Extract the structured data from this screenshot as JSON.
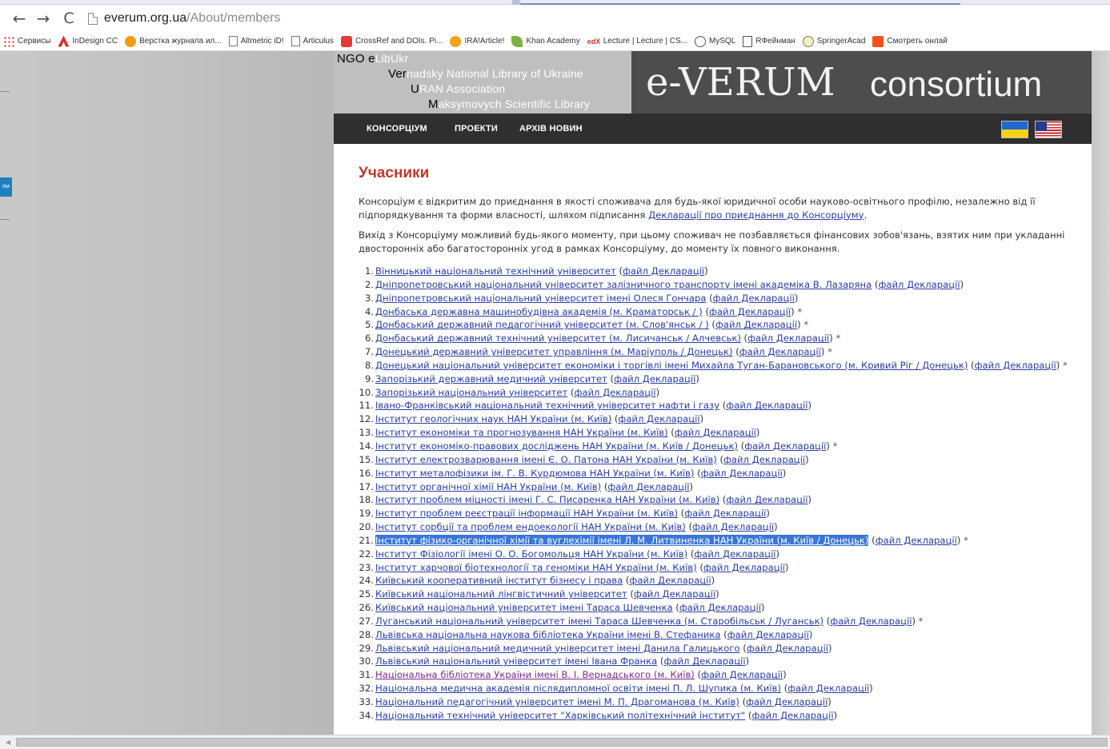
{
  "browser": {
    "url_domain": "everum.org.ua",
    "url_path": "/About/members",
    "back_icon": "←",
    "forward_icon": "→",
    "reload_icon": "C"
  },
  "bookmarks": [
    {
      "icon": "apps-icon",
      "label": "Сервисы"
    },
    {
      "icon": "adobe-icon",
      "label": "InDesign CC"
    },
    {
      "icon": "orange-icon",
      "label": "Верстка журнала ил..."
    },
    {
      "icon": "page-icon",
      "label": "Altmetric iD!"
    },
    {
      "icon": "page-icon",
      "label": "Articulus"
    },
    {
      "icon": "youtube-icon",
      "label": "CrossRef and DOIs. Pi..."
    },
    {
      "icon": "ira-icon",
      "label": "IRA!Article!"
    },
    {
      "icon": "leaf-icon",
      "label": "Khan Academy"
    },
    {
      "icon": "edx-icon",
      "label": "Lecture | Lecture | CS..."
    },
    {
      "icon": "mysql-icon",
      "label": "MySQL"
    },
    {
      "icon": "rf-icon",
      "label": "RФейнман"
    },
    {
      "icon": "springer-icon",
      "label": "SpringerAcad"
    },
    {
      "icon": "smotret-icon",
      "label": "Смотреть онлай"
    }
  ],
  "side_tab_text": "ем",
  "banner": {
    "lines": [
      {
        "hl": "NGO e",
        "rest": "LibUkr"
      },
      {
        "hl": "Ver",
        "rest": "nadsky National Library of Ukraine"
      },
      {
        "hl": "U",
        "rest": "RAN Association"
      },
      {
        "hl": "M",
        "rest": "aksymovych Scientific Library"
      }
    ],
    "logo_left": "e-VERUM",
    "logo_right": "consortium"
  },
  "nav": {
    "items": [
      "КОНСОРЦІУМ",
      "ПРОЕКТИ",
      "АРХІВ НОВИН"
    ]
  },
  "page": {
    "title": "Учасники",
    "para1_text": "Консорціум є відкритим до приєднання в якості споживача для будь-якої юридичної особи науково-освітнього профілю, незалежно від її підпорядкування та форми власності, шляхом підписання ",
    "para1_link": "Декларації про приєднання до Консорціуму",
    "para1_end": ".",
    "para2": "Вихід з Консорціуму можливий будь-якого моменту, при цьому споживач не позбавляється фінансових зобов'язань, взятих ним при укладанні двосторонніх або багатосторонніх угод в рамках Консорціуму, до моменту їх повного виконання.",
    "decl_label": "файл Декларації",
    "members": [
      {
        "n": "1.",
        "name": "Вінницький національний технічний університет",
        "star": ""
      },
      {
        "n": "2.",
        "name": "Дніпропетровський національний університет залізничного транспорту імені академіка В. Лазаряна",
        "star": ""
      },
      {
        "n": "3.",
        "name": "Дніпропетровський національний університет імені Олеся Гончара",
        "star": ""
      },
      {
        "n": "4.",
        "name": "Донбаська державна машинобудівна академія (м. Краматорськ / )",
        "star": "*"
      },
      {
        "n": "5.",
        "name": "Донбаський державний педагогічний університет (м. Слов'янськ / )",
        "star": "*"
      },
      {
        "n": "6.",
        "name": "Донбаський державний технічний університет (м. Лисичанськ / Алчевськ)",
        "star": "*"
      },
      {
        "n": "7.",
        "name": "Донецький державний університет управління (м. Маріуполь / Донецьк)",
        "star": "*"
      },
      {
        "n": "8.",
        "name": "Донецький національний університет економіки і торгівлі імені Михайла Туган-Барановського (м. Кривий Ріг / Донецьк)",
        "star": "*"
      },
      {
        "n": "9.",
        "name": "Запорізький державний медичний університет",
        "star": ""
      },
      {
        "n": "10.",
        "name": "Запорізький національний університет",
        "star": ""
      },
      {
        "n": "11.",
        "name": "Івано-Франківський національний технічний університет нафти і газу",
        "star": ""
      },
      {
        "n": "12.",
        "name": "Інститут геологічних наук НАН України (м. Київ)",
        "star": ""
      },
      {
        "n": "13.",
        "name": "Інститут економіки та прогнозування НАН України (м. Київ)",
        "star": ""
      },
      {
        "n": "14.",
        "name": "Інститут економіко-правових досліджень НАН України (м. Київ / Донецьк)",
        "star": "*"
      },
      {
        "n": "15.",
        "name": "Інститут електрозварювання імені Є. О. Патона НАН України (м. Київ)",
        "star": ""
      },
      {
        "n": "16.",
        "name": "Інститут металофізики ім. Г. В. Курдюмова НАН України (м. Київ)",
        "star": ""
      },
      {
        "n": "17.",
        "name": "Інститут органічної хімії НАН України (м. Київ)",
        "star": ""
      },
      {
        "n": "18.",
        "name": "Інститут проблем міцності імені Г. С. Писаренка НАН України (м. Київ)",
        "star": ""
      },
      {
        "n": "19.",
        "name": "Інститут проблем реєстрації інформації НАН України (м. Київ)",
        "star": ""
      },
      {
        "n": "20.",
        "name": "Інститут сорбції та проблем ендоекології НАН України (м. Київ)",
        "star": ""
      },
      {
        "n": "21.",
        "name": "Інститут фізико-органічної хімії та вуглехімії імені Л. М. Литвиненка НАН України (м. Київ / Донецьк)",
        "star": "*"
      },
      {
        "n": "22.",
        "name": "Інститут Фізіології імені О. О. Богомольця НАН України (м. Київ)",
        "star": ""
      },
      {
        "n": "23.",
        "name": "Інститут харчової біотехнології та геноміки НАН України (м. Київ)",
        "star": ""
      },
      {
        "n": "24.",
        "name": "Київський кооперативний інститут бізнесу і права",
        "star": ""
      },
      {
        "n": "25.",
        "name": "Київський національний лінгвістичний університет",
        "star": ""
      },
      {
        "n": "26.",
        "name": "Київський національний університет імені Тараса Шевченка",
        "star": ""
      },
      {
        "n": "27.",
        "name": "Луганський національний університет імені Тараса Шевченка (м. Старобільськ / Луганськ)",
        "star": "*"
      },
      {
        "n": "28.",
        "name": "Львівська національна наукова бібліотека України імені В. Стефаника",
        "star": ""
      },
      {
        "n": "29.",
        "name": "Львівський національний медичний університет імені Данила Галицького",
        "star": ""
      },
      {
        "n": "30.",
        "name": "Львівський національний університет імені Івана Франка",
        "star": ""
      },
      {
        "n": "31.",
        "name": "Національна бібліотека України імені В. І. Вернадського (м. Київ)",
        "star": ""
      },
      {
        "n": "32.",
        "name": "Національна медична академія післядипломної освіти імені П. Л. Шупика (м. Київ)",
        "star": ""
      },
      {
        "n": "33.",
        "name": "Національний педагогічний університет імені М. П. Драгоманова (м. Київ)",
        "star": ""
      },
      {
        "n": "34.",
        "name": "Національний технічний університет \"Харківський політехнічний інститут\"",
        "star": ""
      }
    ]
  }
}
